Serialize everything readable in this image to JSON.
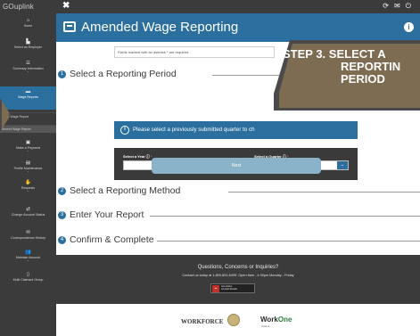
{
  "app": {
    "logo": "GOuplink",
    "close_label": "✖",
    "top_icons": [
      "refresh-icon",
      "email-icon",
      "power-icon"
    ]
  },
  "sidebar": {
    "items": [
      {
        "label": "Home",
        "icon": "home-icon",
        "chevron": false
      },
      {
        "label": "Select an Employer",
        "icon": "building-icon",
        "chevron": false
      },
      {
        "label": "Summary Information",
        "icon": "list-icon",
        "chevron": true
      },
      {
        "label": "Wage Reports",
        "icon": "briefcase-icon",
        "chevron": true,
        "active": true
      }
    ],
    "sub_items": [
      {
        "label": "File a Wage Report"
      },
      {
        "label": "Amend Wage Report",
        "selected": true
      }
    ],
    "items2": [
      {
        "label": "Make a Payment",
        "icon": "money-icon",
        "chevron": true
      },
      {
        "label": "Profile Maintenance",
        "icon": "profile-icon",
        "chevron": true
      },
      {
        "label": "Requests",
        "icon": "requests-icon",
        "chevron": true
      },
      {
        "label": "Change Account Status",
        "icon": "status-icon",
        "chevron": false
      },
      {
        "label": "Correspondence History",
        "icon": "mail-icon",
        "chevron": false
      },
      {
        "label": "Maintain Account",
        "icon": "users-icon",
        "chevron": true
      },
      {
        "label": "Multi Claimant Group",
        "icon": "group-icon",
        "chevron": false
      }
    ]
  },
  "header": {
    "title": "Amended Wage Reporting",
    "info_label": "i"
  },
  "required_note": "Fields marked with an asterisk * are required.",
  "sections": [
    {
      "number": "1",
      "label": "Select a Reporting Period"
    },
    {
      "number": "2",
      "label": "Select a Reporting Method"
    },
    {
      "number": "3",
      "label": "Enter Your Report"
    },
    {
      "number": "4",
      "label": "Confirm & Complete"
    }
  ],
  "banner": {
    "icon": "info-icon",
    "text": "Please select a previously submitted quarter to ch"
  },
  "selects": {
    "year_label": "Select a Year",
    "year_value": "",
    "quarter_label": "Select a Quarter",
    "quarter_value": "",
    "required_mark": "*"
  },
  "next_button": "Next",
  "callout": {
    "line1": "STEP 3. SELECT A",
    "line2": "REPORTIN",
    "line3": "PERIOD"
  },
  "footer": {
    "question": "Questions, Concerns or Inquiries?",
    "contact": "Contact us today at 1-800-891-6499. Open 8am - 4:30pm Monday - Friday",
    "reader_line1": "Get Adobe",
    "reader_line2": "Acrobat Reader"
  },
  "logos": {
    "workforce": "WORKFORCE",
    "workone_prefix": "Work",
    "workone_suffix": "One",
    "workone_sub": "Indiana"
  },
  "colors": {
    "brand_blue": "#2b6f9e",
    "dark_bar": "#3b3b3b",
    "callout_brown": "#7d6c51",
    "next_button": "#8ab2c9"
  }
}
